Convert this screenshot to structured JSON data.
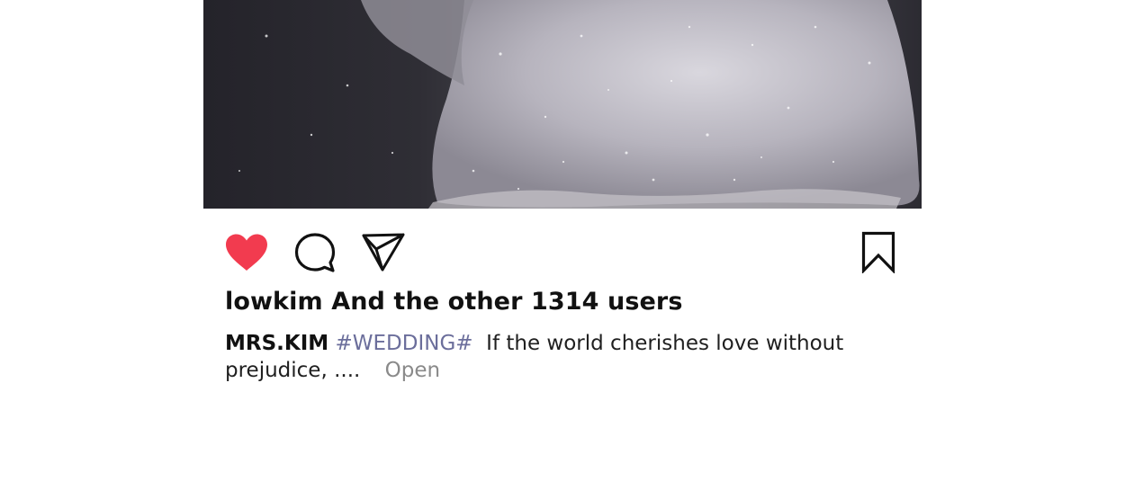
{
  "post": {
    "image_alt": "",
    "actions": {
      "like_icon": "heart-filled-icon",
      "comment_icon": "speech-bubble-icon",
      "share_icon": "paper-plane-icon",
      "save_icon": "bookmark-icon",
      "like_color": "#f23b4f"
    },
    "likes_text": "lowkim And the other 1314 users",
    "caption": {
      "user": "MRS.KIM",
      "hashtag": "#WEDDING#",
      "text": "If the world cherishes love without prejudice, ....",
      "more_label": "Open"
    }
  }
}
